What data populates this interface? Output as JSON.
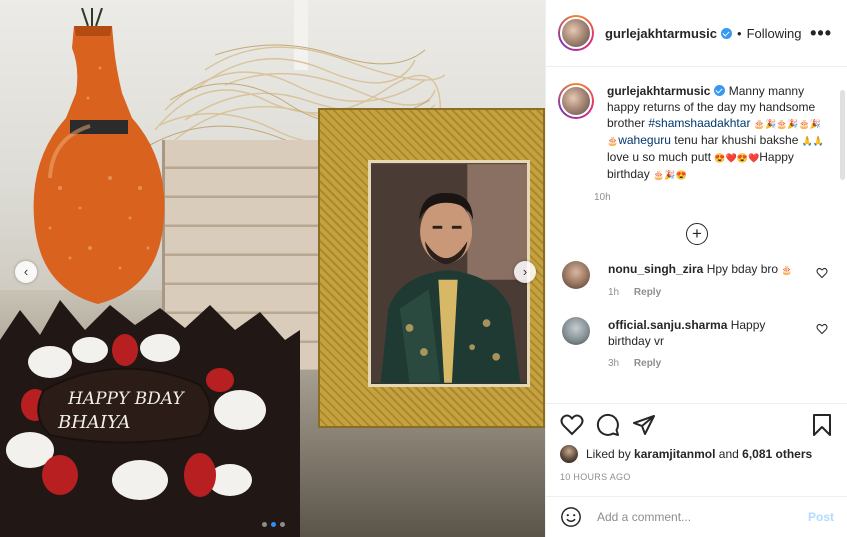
{
  "post": {
    "username": "gurlejakhtarmusic",
    "follow_label": "Following",
    "bullet": "•",
    "more_label": "•••",
    "caption": {
      "username": "gurlejakhtarmusic",
      "text_1": "Manny manny happy returns of the day my handsome brother",
      "hashtag": "#shamshaadakhtar",
      "emoji_1": "🎂🎉🎂🎉🎂🎉🎂",
      "waheguru": "waheguru",
      "text_2": "tenu har khushi bakshe",
      "emoji_2": "🙏🙏",
      "text_3": "love u so much putt",
      "emoji_3": "😍❤️😍❤️",
      "text_4": "Happy birthday",
      "emoji_4": "🎂🎉😍",
      "time": "10h"
    },
    "comments": [
      {
        "username": "nonu_singh_zira",
        "text": "Hpy bday bro",
        "emoji": "🎂",
        "time": "1h",
        "reply": "Reply",
        "avatar_color": "#b99a84"
      },
      {
        "username": "official.sanju.sharma",
        "text": "Happy birthday vr",
        "emoji": "",
        "time": "3h",
        "reply": "Reply",
        "avatar_color": "#7f8a8e"
      }
    ],
    "likes": {
      "prefix": "Liked by",
      "user": "karamjitanmol",
      "conjunction": "and",
      "others": "6,081 others"
    },
    "timestamp": "10 HOURS AGO",
    "add_comment_placeholder": "Add a comment...",
    "post_button": "Post"
  },
  "photo": {
    "prev_arrow": "‹",
    "next_arrow": "›",
    "carousel": {
      "count": 3,
      "active_index": 1
    },
    "cake_text_1": "HAPPY BDAY",
    "cake_text_2": "BHAIYA"
  },
  "colors": {
    "link": "#00376b",
    "verified": "#3897f0",
    "post_button": "#b3dbff",
    "frame_gold": "#c6a23f"
  }
}
